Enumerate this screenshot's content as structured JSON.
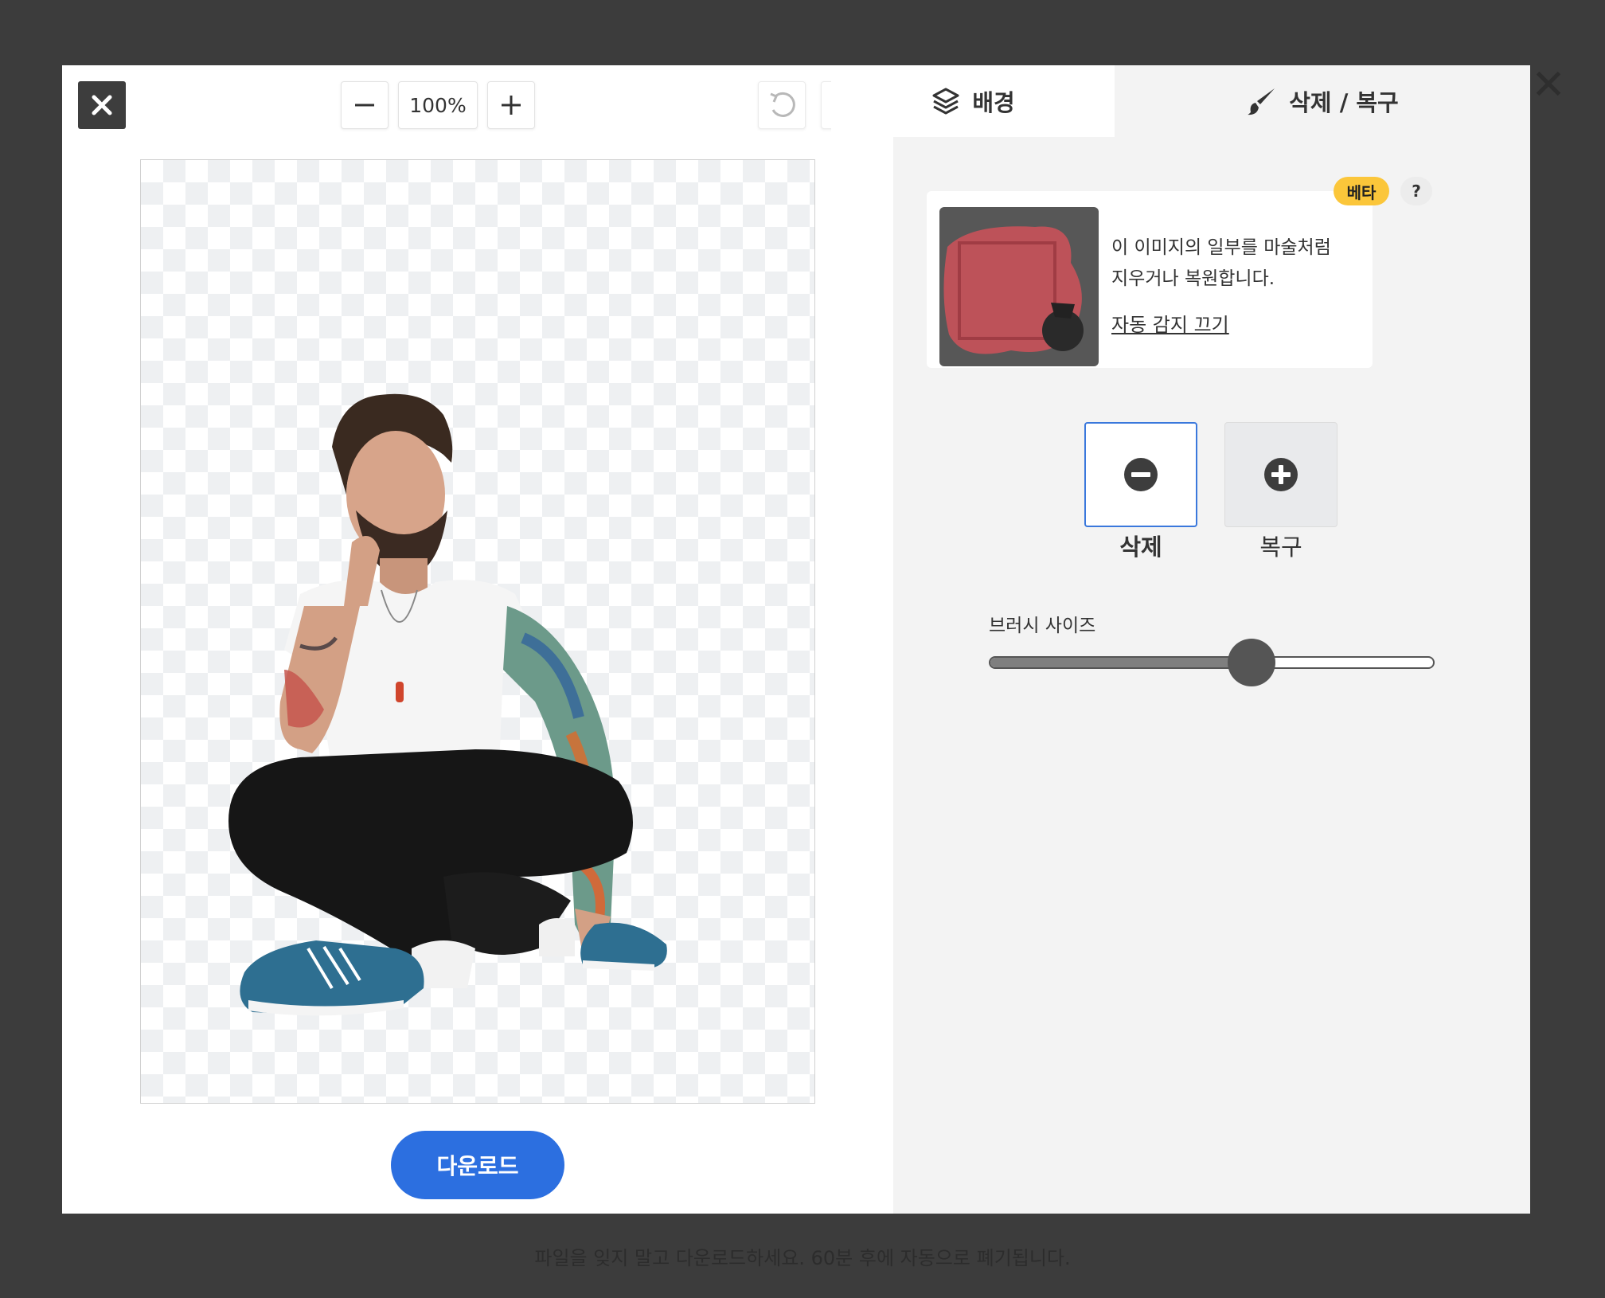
{
  "toolbar": {
    "zoom_value": "100%",
    "zoom_out_icon": "minus-icon",
    "zoom_in_icon": "plus-icon",
    "undo_icon": "undo-icon",
    "redo_icon": "redo-icon",
    "close_icon": "close-icon"
  },
  "tabs": [
    {
      "label": "배경",
      "icon": "layers-icon"
    },
    {
      "label": "삭제 / 복구",
      "icon": "brush-icon"
    }
  ],
  "info_card": {
    "badge": "베타",
    "help": "?",
    "line1": "이 이미지의 일부를 마술처럼",
    "line2": "지우거나 복원합니다.",
    "link": "자동 감지 끄기"
  },
  "modes": {
    "erase_label": "삭제",
    "restore_label": "복구",
    "selected": "erase"
  },
  "brush": {
    "label": "브러시 사이즈",
    "value_fraction": 0.59
  },
  "download_label": "다운로드",
  "footer_note": "파일을 잊지 말고 다운로드하세요. 60분 후에 자동으로 폐기됩니다.",
  "colors": {
    "accent": "#2c6fe0",
    "badge": "#fbc63a",
    "modal_dark": "#3d3d3d"
  }
}
